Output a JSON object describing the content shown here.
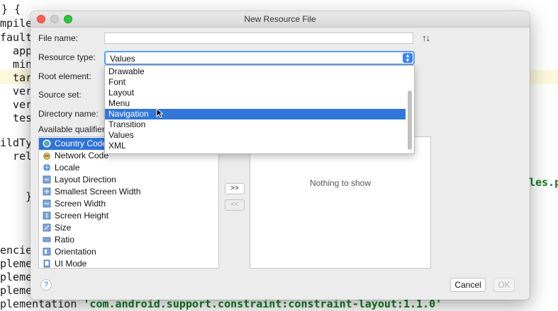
{
  "code_editor": {
    "lines": [
      "} {",
      "mpileS",
      "faultC",
      "  app",
      "  minS",
      "  tar",
      "  vers",
      "  vers",
      "  test",
      "ildTyp",
      "  rele",
      "    }",
      "encies",
      "plemen",
      "plemen",
      "plemen",
      "plementation "
    ],
    "dependency_string": "'com.android.support.constraint:constraint-layout:1.1.0'",
    "right_fragment": "les.p"
  },
  "dialog": {
    "title": "New Resource File",
    "labels": {
      "file_name": "File name:",
      "resource_type": "Resource type:",
      "root_element": "Root element:",
      "source_set": "Source set:",
      "directory_name": "Directory name:",
      "available_qualifiers": "Available qualifier"
    },
    "file_name_value": "",
    "resource_type_value": "Values",
    "resource_type_options": [
      "Drawable",
      "Font",
      "Layout",
      "Menu",
      "Navigation",
      "Transition",
      "Values",
      "XML"
    ],
    "highlighted_option": "Navigation",
    "qualifiers": [
      {
        "label": "Country Code",
        "icon": "globe-icon"
      },
      {
        "label": "Network Code",
        "icon": "network-icon"
      },
      {
        "label": "Locale",
        "icon": "locale-icon"
      },
      {
        "label": "Layout Direction",
        "icon": "layout-direction-icon"
      },
      {
        "label": "Smallest Screen Width",
        "icon": "smallest-width-icon"
      },
      {
        "label": "Screen Width",
        "icon": "screen-width-icon"
      },
      {
        "label": "Screen Height",
        "icon": "screen-height-icon"
      },
      {
        "label": "Size",
        "icon": "size-icon"
      },
      {
        "label": "Ratio",
        "icon": "ratio-icon"
      },
      {
        "label": "Orientation",
        "icon": "orientation-icon"
      },
      {
        "label": "UI Mode",
        "icon": "ui-mode-icon"
      }
    ],
    "add_button": ">>",
    "remove_button": "<<",
    "chosen_empty_text": "Nothing to show",
    "help_label": "?",
    "cancel_label": "Cancel",
    "ok_label": "OK"
  }
}
